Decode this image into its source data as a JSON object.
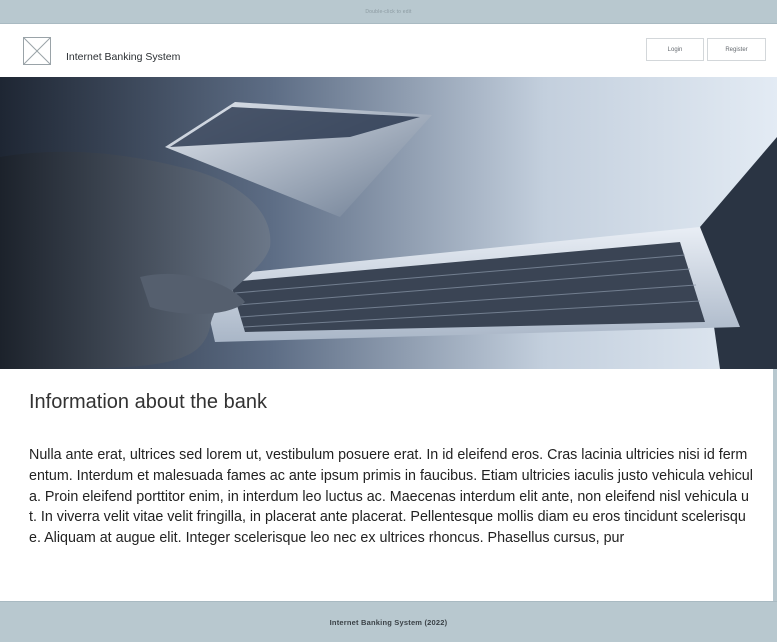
{
  "topbar": {
    "hint": "Double-click to edit"
  },
  "header": {
    "title": "Internet Banking System",
    "login_label": "Login",
    "register_label": "Register"
  },
  "hero": {
    "image": "hand-holding-credit-card-over-laptop-keyboard"
  },
  "content": {
    "heading": "Information about the bank",
    "paragraph": "Nulla ante erat, ultrices sed lorem ut, vestibulum posuere erat. In id eleifend eros. Cras lacinia ultricies nisi id fermentum. Interdum et malesuada fames ac ante ipsum primis in faucibus. Etiam ultricies iaculis justo vehicula vehicula. Proin eleifend porttitor enim, in interdum leo luctus ac. Maecenas interdum elit ante, non eleifend nisl vehicula ut. In viverra velit vitae velit fringilla, in placerat ante placerat. Pellentesque mollis diam eu eros tincidunt scelerisque. Aliquam at augue elit. Integer scelerisque leo nec ex ultrices rhoncus. Phasellus cursus, pur"
  },
  "footer": {
    "text": "Internet Banking System (2022)"
  },
  "colors": {
    "frame": "#b8c8cf",
    "surface": "#ffffff",
    "text": "#222222"
  }
}
